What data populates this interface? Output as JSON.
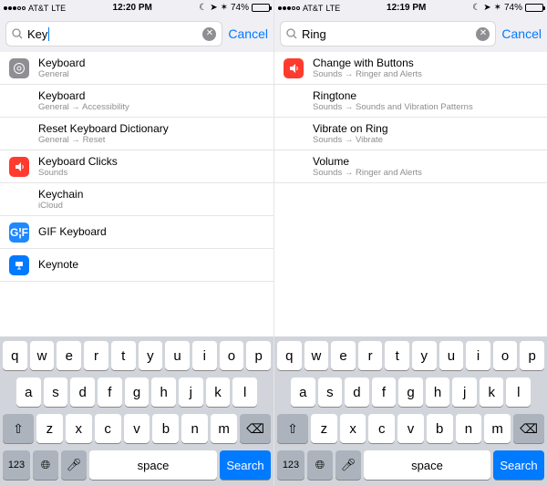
{
  "left": {
    "status": {
      "carrier": "AT&T",
      "network": "LTE",
      "time": "12:20 PM",
      "battery_pct": "74%"
    },
    "search": {
      "query": "Key",
      "cancel": "Cancel"
    },
    "results": [
      {
        "icon": "general",
        "title": "Keyboard",
        "sub": "General"
      },
      {
        "icon": "",
        "title": "Keyboard",
        "sub": "General → Accessibility"
      },
      {
        "icon": "",
        "title": "Reset Keyboard Dictionary",
        "sub": "General → Reset"
      },
      {
        "icon": "sounds",
        "title": "Keyboard Clicks",
        "sub": "Sounds"
      },
      {
        "icon": "cloud",
        "title": "Keychain",
        "sub": "iCloud"
      },
      {
        "icon": "gif",
        "title": "GIF Keyboard",
        "sub": ""
      },
      {
        "icon": "keynote",
        "title": "Keynote",
        "sub": ""
      }
    ]
  },
  "right": {
    "status": {
      "carrier": "AT&T",
      "network": "LTE",
      "time": "12:19 PM",
      "battery_pct": "74%"
    },
    "search": {
      "query": "Ring",
      "cancel": "Cancel"
    },
    "results": [
      {
        "icon": "sounds",
        "title": "Change with Buttons",
        "sub": "Sounds → Ringer and Alerts"
      },
      {
        "icon": "",
        "title": "Ringtone",
        "sub": "Sounds → Sounds and Vibration Patterns"
      },
      {
        "icon": "",
        "title": "Vibrate on Ring",
        "sub": "Sounds → Vibrate"
      },
      {
        "icon": "",
        "title": "Volume",
        "sub": "Sounds → Ringer and Alerts"
      }
    ]
  },
  "keyboard": {
    "row1": [
      "q",
      "w",
      "e",
      "r",
      "t",
      "y",
      "u",
      "i",
      "o",
      "p"
    ],
    "row2": [
      "a",
      "s",
      "d",
      "f",
      "g",
      "h",
      "j",
      "k",
      "l"
    ],
    "row3": [
      "z",
      "x",
      "c",
      "v",
      "b",
      "n",
      "m"
    ],
    "numkey": "123",
    "space": "space",
    "search": "Search"
  }
}
